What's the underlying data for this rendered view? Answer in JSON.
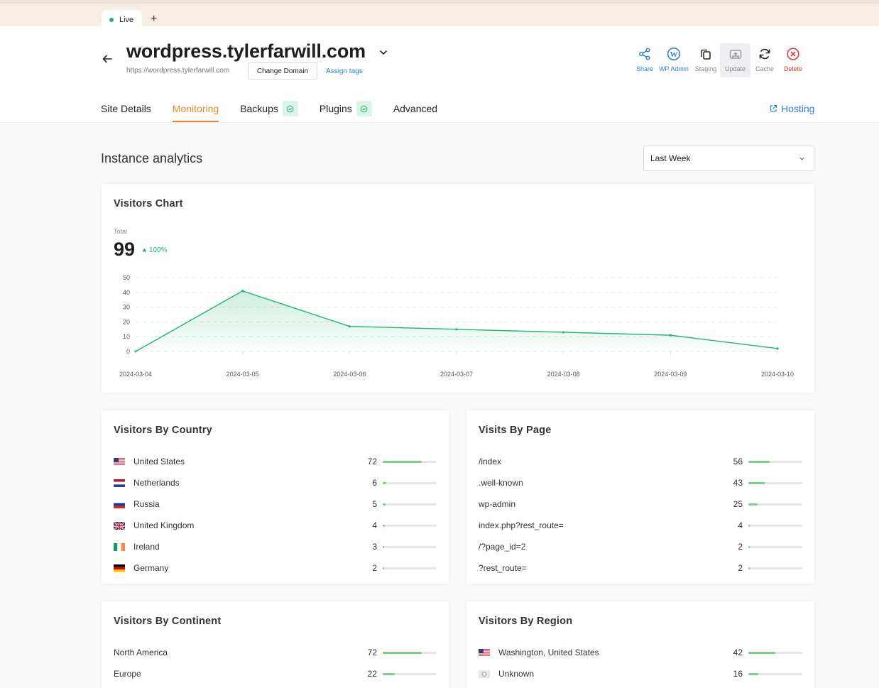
{
  "tabstrip": {
    "live_label": "Live",
    "add_label": "+"
  },
  "site": {
    "title": "wordpress.tylerfarwill.com",
    "url": "https://wordpress.tylerfarwill.com",
    "change_domain": "Change Domain",
    "assign_tags": "Assign tags"
  },
  "actions": {
    "share": "Share",
    "wp_admin": "WP Admin",
    "staging": "Staging",
    "update": "Update",
    "cache": "Cache",
    "delete": "Delete"
  },
  "nav": {
    "site_details": "Site Details",
    "monitoring": "Monitoring",
    "backups": "Backups",
    "plugins": "Plugins",
    "advanced": "Advanced",
    "hosting": "Hosting"
  },
  "analytics": {
    "title": "Instance analytics",
    "period": "Last Week"
  },
  "visitors_chart": {
    "title": "Visitors Chart",
    "total_label": "Total",
    "total_value": "99",
    "total_change": "100%"
  },
  "chart_data": {
    "type": "area",
    "x": [
      "2024-03-04",
      "2024-03-05",
      "2024-03-06",
      "2024-03-07",
      "2024-03-08",
      "2024-03-09",
      "2024-03-10"
    ],
    "series": [
      {
        "values": [
          0,
          41,
          17,
          15,
          13,
          11,
          2
        ]
      }
    ],
    "ylim": [
      0,
      50
    ],
    "yticks": [
      0,
      10,
      20,
      30,
      40,
      50
    ],
    "grid": true,
    "color": "#22b573"
  },
  "countries": {
    "title": "Visitors By Country",
    "max": 100,
    "items": [
      {
        "label": "United States",
        "value": 72,
        "flag": "us"
      },
      {
        "label": "Netherlands",
        "value": 6,
        "flag": "nl"
      },
      {
        "label": "Russia",
        "value": 5,
        "flag": "ru"
      },
      {
        "label": "United Kingdom",
        "value": 4,
        "flag": "gb"
      },
      {
        "label": "Ireland",
        "value": 3,
        "flag": "ie"
      },
      {
        "label": "Germany",
        "value": 2,
        "flag": "de"
      }
    ]
  },
  "pages": {
    "title": "Visits By Page",
    "max": 141,
    "items": [
      {
        "label": "/index",
        "value": 56
      },
      {
        "label": ".well-known",
        "value": 43
      },
      {
        "label": "wp-admin",
        "value": 25
      },
      {
        "label": "index.php?rest_route=",
        "value": 4
      },
      {
        "label": "/?page_id=2",
        "value": 2
      },
      {
        "label": "?rest_route=",
        "value": 2
      }
    ]
  },
  "continents": {
    "title": "Visitors By Continent",
    "max": 100,
    "items": [
      {
        "label": "North America",
        "value": 72
      },
      {
        "label": "Europe",
        "value": 22
      }
    ]
  },
  "regions": {
    "title": "Visitors By Region",
    "max": 84,
    "items": [
      {
        "label": "Washington, United States",
        "value": 42,
        "flag": "us"
      },
      {
        "label": "Unknown",
        "value": 16,
        "flag": "unknown"
      }
    ]
  }
}
